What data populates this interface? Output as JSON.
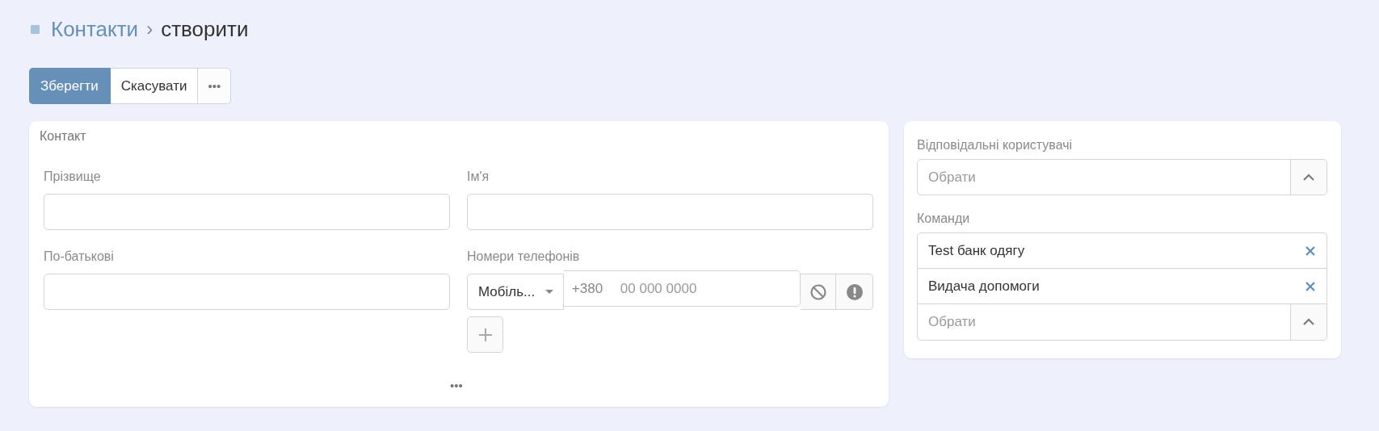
{
  "breadcrumb": {
    "parent": "Контакти",
    "separator": "›",
    "current": "створити"
  },
  "toolbar": {
    "buttons": [
      {
        "label": "Зберегти",
        "kind": "primary"
      },
      {
        "label": "Скасувати",
        "kind": "default"
      },
      {
        "label": "•••",
        "kind": "more"
      }
    ]
  },
  "contact_card": {
    "title": "Контакт",
    "fields": [
      {
        "label": "Прізвище",
        "kind": "text"
      },
      {
        "label": "Ім'я",
        "kind": "text"
      },
      {
        "label": "По-батькові",
        "kind": "text"
      },
      {
        "label": "Номери телефонів",
        "kind": "phones",
        "phones": [
          {
            "type": "Мобіль...",
            "prefix": "+380",
            "placeholder": "00 000 0000"
          }
        ]
      }
    ],
    "more": "•••"
  },
  "side_card": {
    "users": {
      "label": "Відповідальні користувачі",
      "placeholder": "Обрати"
    },
    "teams": {
      "label": "Команди",
      "items": [
        "Test банк одягу",
        "Видача допомоги"
      ],
      "placeholder": "Обрати"
    }
  }
}
